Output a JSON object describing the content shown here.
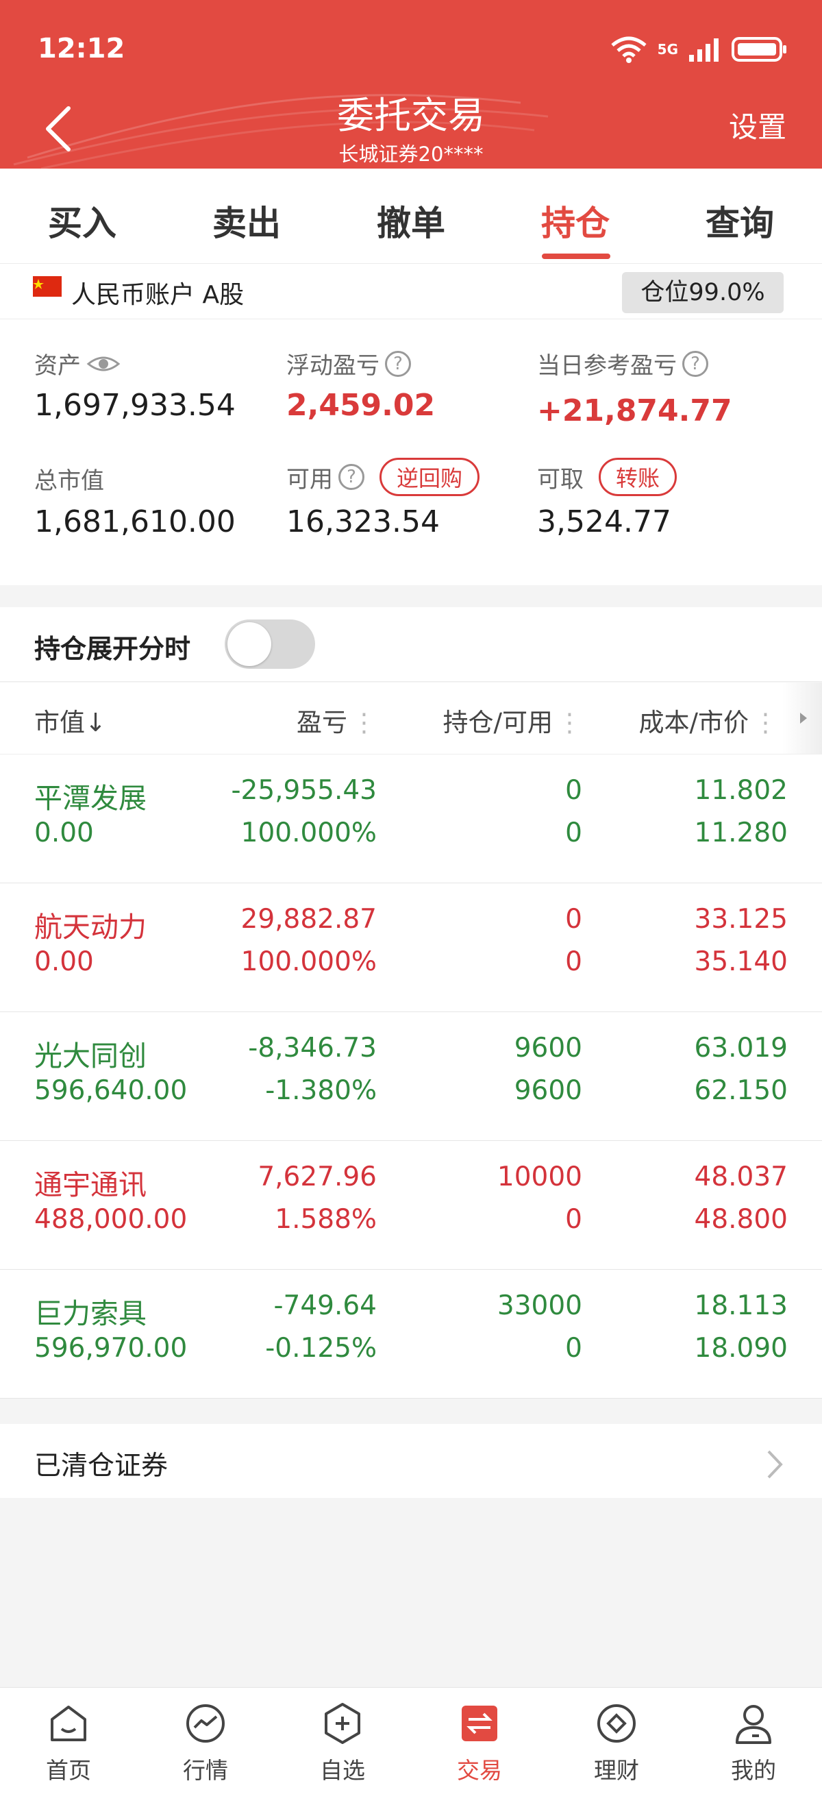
{
  "status_bar": {
    "time": "12:12",
    "network": "5G"
  },
  "header": {
    "title": "委托交易",
    "subtitle": "长城证券20****",
    "settings_label": "设置"
  },
  "tabs": [
    {
      "label": "买入"
    },
    {
      "label": "卖出"
    },
    {
      "label": "撤单"
    },
    {
      "label": "持仓",
      "active": true
    },
    {
      "label": "查询"
    }
  ],
  "account": {
    "label": "人民币账户 A股",
    "position_ratio": "仓位99.0%"
  },
  "summary": {
    "assets_label": "资产",
    "assets_value": "1,697,933.54",
    "floating_pl_label": "浮动盈亏",
    "floating_pl_value": "2,459.02",
    "daily_pl_label": "当日参考盈亏",
    "daily_pl_value": "+21,874.77",
    "market_value_label": "总市值",
    "market_value": "1,681,610.00",
    "available_label": "可用",
    "available_value": "16,323.54",
    "repo_button": "逆回购",
    "withdrawable_label": "可取",
    "withdrawable_value": "3,524.77",
    "transfer_button": "转账"
  },
  "toggle": {
    "label": "持仓展开分时",
    "on": false
  },
  "table": {
    "headers": {
      "market_value": "市值↓",
      "pl": "盈亏",
      "holding": "持仓/可用",
      "cost": "成本/市价"
    },
    "rows": [
      {
        "name": "平潭发展",
        "market_value": "0.00",
        "pl": "-25,955.43",
        "pl_pct": "100.000%",
        "holding": "0",
        "available": "0",
        "cost": "11.802",
        "price": "11.280",
        "trend": "down"
      },
      {
        "name": "航天动力",
        "market_value": "0.00",
        "pl": "29,882.87",
        "pl_pct": "100.000%",
        "holding": "0",
        "available": "0",
        "cost": "33.125",
        "price": "35.140",
        "trend": "up"
      },
      {
        "name": "光大同创",
        "market_value": "596,640.00",
        "pl": "-8,346.73",
        "pl_pct": "-1.380%",
        "holding": "9600",
        "available": "9600",
        "cost": "63.019",
        "price": "62.150",
        "trend": "down"
      },
      {
        "name": "通宇通讯",
        "market_value": "488,000.00",
        "pl": "7,627.96",
        "pl_pct": "1.588%",
        "holding": "10000",
        "available": "0",
        "cost": "48.037",
        "price": "48.800",
        "trend": "up"
      },
      {
        "name": "巨力索具",
        "market_value": "596,970.00",
        "pl": "-749.64",
        "pl_pct": "-0.125%",
        "holding": "33000",
        "available": "0",
        "cost": "18.113",
        "price": "18.090",
        "trend": "down"
      }
    ]
  },
  "cleared": {
    "label": "已清仓证券"
  },
  "nav": [
    {
      "label": "首页",
      "icon": "home-icon"
    },
    {
      "label": "行情",
      "icon": "market-icon"
    },
    {
      "label": "自选",
      "icon": "watchlist-icon"
    },
    {
      "label": "交易",
      "icon": "trade-icon",
      "active": true
    },
    {
      "label": "理财",
      "icon": "wealth-icon"
    },
    {
      "label": "我的",
      "icon": "profile-icon"
    }
  ],
  "colors": {
    "brand": "#e24a41",
    "up": "#d4333b",
    "down": "#2f8a3e"
  }
}
